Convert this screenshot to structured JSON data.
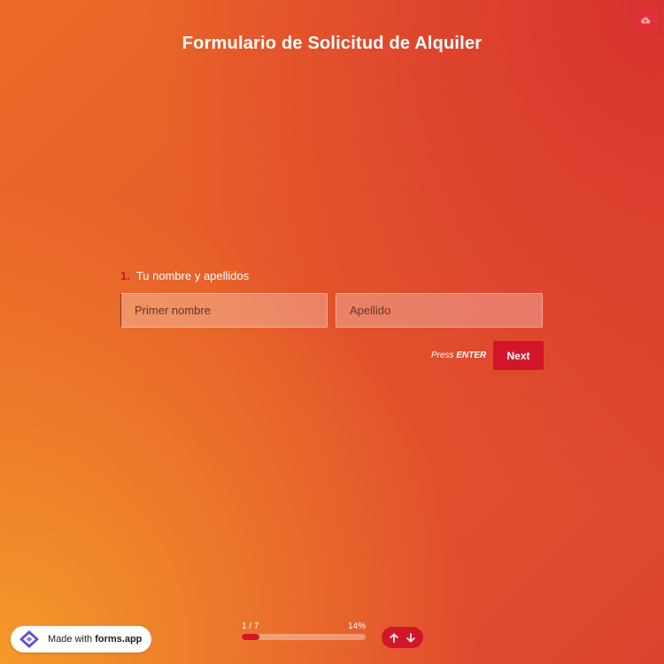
{
  "form": {
    "title": "Formulario de Solicitud de Alquiler",
    "question": {
      "number": "1.",
      "label": "Tu nombre y apellidos",
      "first_name_placeholder": "Primer nombre",
      "last_name_placeholder": "Apellido"
    },
    "hint_prefix": "Press ",
    "hint_key": "ENTER",
    "next_label": "Next"
  },
  "toolbar": {
    "save_icon": "cloud-upload-icon"
  },
  "footer": {
    "badge_prefix": "Made with ",
    "badge_brand": "forms.app",
    "logo_icon": "forms-app-logo-icon",
    "progress": {
      "count_text": "1 / 7",
      "percent_text": "14%",
      "fraction": 0.14
    },
    "nav": {
      "up_icon": "arrow-up-icon",
      "down_icon": "arrow-down-icon"
    }
  },
  "colors": {
    "accent": "#d3152a",
    "gradient_start": "#f59a2a",
    "gradient_end": "#d7322f"
  }
}
